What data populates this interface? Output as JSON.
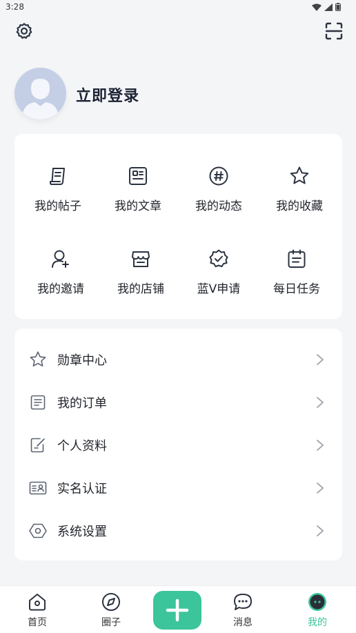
{
  "status_bar": {
    "time": "3:28"
  },
  "profile": {
    "login_label": "立即登录"
  },
  "quick_grid": [
    {
      "label": "我的帖子",
      "icon": "post-icon"
    },
    {
      "label": "我的文章",
      "icon": "article-icon"
    },
    {
      "label": "我的动态",
      "icon": "hashtag-icon"
    },
    {
      "label": "我的收藏",
      "icon": "star-icon"
    },
    {
      "label": "我的邀请",
      "icon": "invite-user-icon"
    },
    {
      "label": "我的店铺",
      "icon": "store-icon"
    },
    {
      "label": "蓝V申请",
      "icon": "verified-badge-icon"
    },
    {
      "label": "每日任务",
      "icon": "calendar-task-icon"
    }
  ],
  "menu_list": [
    {
      "label": "勋章中心",
      "icon": "star-outline-icon"
    },
    {
      "label": "我的订单",
      "icon": "order-list-icon"
    },
    {
      "label": "个人资料",
      "icon": "edit-profile-icon"
    },
    {
      "label": "实名认证",
      "icon": "id-card-icon"
    },
    {
      "label": "系统设置",
      "icon": "hexagon-settings-icon"
    }
  ],
  "bottom_nav": [
    {
      "label": "首页",
      "icon": "home-icon"
    },
    {
      "label": "圈子",
      "icon": "compass-icon"
    },
    {
      "label": "消息",
      "icon": "message-icon"
    },
    {
      "label": "我的",
      "icon": "profile-face-icon",
      "active": true
    }
  ],
  "colors": {
    "accent": "#3cc49a",
    "background": "#f4f5f7",
    "card": "#ffffff",
    "text": "#1f2329",
    "icon_stroke": "#2b3340"
  }
}
